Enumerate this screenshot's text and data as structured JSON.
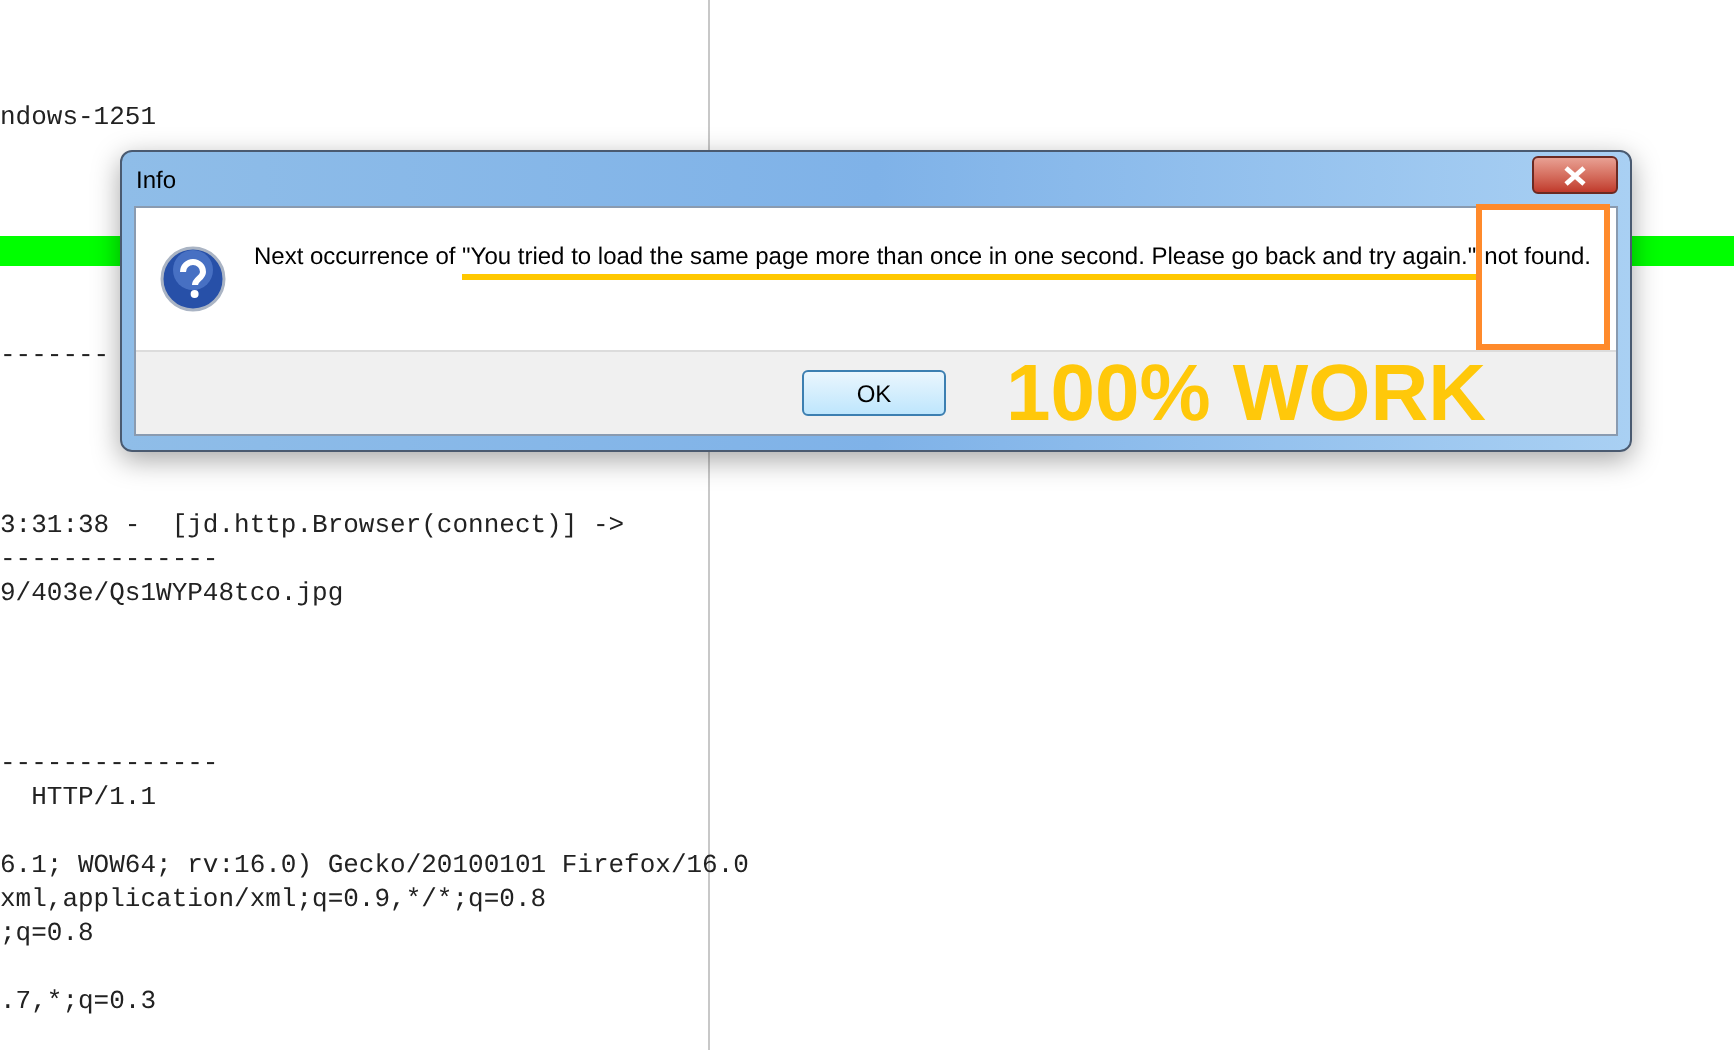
{
  "log_lines": [
    {
      "kind": "text",
      "text": "ndows-1251"
    },
    {
      "kind": "blank"
    },
    {
      "kind": "blank"
    },
    {
      "kind": "blank"
    },
    {
      "kind": "blank"
    },
    {
      "kind": "blank"
    },
    {
      "kind": "blank"
    },
    {
      "kind": "text",
      "text": "-------"
    },
    {
      "kind": "blank"
    },
    {
      "kind": "blank"
    },
    {
      "kind": "blank"
    },
    {
      "kind": "blank"
    },
    {
      "kind": "text",
      "text": "3:31:38 -  [jd.http.Browser(connect)] ->"
    },
    {
      "kind": "text",
      "text": "--------------"
    },
    {
      "kind": "text",
      "text": "9/403e/Qs1WYP48tco.jpg"
    },
    {
      "kind": "blank"
    },
    {
      "kind": "blank"
    },
    {
      "kind": "blank"
    },
    {
      "kind": "blank"
    },
    {
      "kind": "text",
      "text": "--------------"
    },
    {
      "kind": "text",
      "text": "  HTTP/1.1"
    },
    {
      "kind": "blank"
    },
    {
      "kind": "text",
      "text": "6.1; WOW64; rv:16.0) Gecko/20100101 Firefox/16.0"
    },
    {
      "kind": "text",
      "text": "xml,application/xml;q=0.9,*/*;q=0.8"
    },
    {
      "kind": "text",
      "text": ";q=0.8"
    },
    {
      "kind": "blank"
    },
    {
      "kind": "text",
      "text": ".7,*;q=0.3"
    }
  ],
  "dialog": {
    "title": "Info",
    "message": {
      "before": "Next occurrence of ",
      "highlighted": "\"You tried to load the same page more than once in one second. Please go back and try again.\"",
      "after": " not found."
    },
    "buttons": [
      "OK"
    ]
  },
  "overlay_caption": "100% WORK"
}
